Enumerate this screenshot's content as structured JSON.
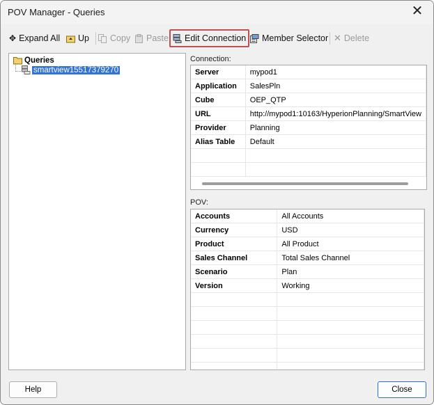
{
  "window": {
    "title": "POV Manager - Queries",
    "close_glyph": "✕"
  },
  "toolbar": {
    "expand_all": "Expand All",
    "up": "Up",
    "copy": "Copy",
    "paste": "Paste",
    "edit_connection": "Edit Connection",
    "member_selector": "Member Selector",
    "delete": "Delete"
  },
  "tree": {
    "root_label": "Queries",
    "items": [
      {
        "label": "smartview15517379270"
      }
    ]
  },
  "connection": {
    "label": "Connection:",
    "rows": [
      {
        "key": "Server",
        "value": "mypod1"
      },
      {
        "key": "Application",
        "value": "SalesPln"
      },
      {
        "key": "Cube",
        "value": "OEP_QTP"
      },
      {
        "key": "URL",
        "value": "http://mypod1:10163/HyperionPlanning/SmartView"
      },
      {
        "key": "Provider",
        "value": "Planning"
      },
      {
        "key": "Alias Table",
        "value": "Default"
      }
    ]
  },
  "pov": {
    "label": "POV:",
    "rows": [
      {
        "key": "Accounts",
        "value": "All Accounts"
      },
      {
        "key": "Currency",
        "value": "USD"
      },
      {
        "key": "Product",
        "value": "All Product"
      },
      {
        "key": "Sales Channel",
        "value": "Total Sales Channel"
      },
      {
        "key": "Scenario",
        "value": "Plan"
      },
      {
        "key": "Version",
        "value": "Working"
      }
    ]
  },
  "footer": {
    "help": "Help",
    "close": "Close"
  },
  "colors": {
    "selection": "#3373d6",
    "highlight_border": "#c0504d",
    "primary_border": "#2b6fd6"
  }
}
